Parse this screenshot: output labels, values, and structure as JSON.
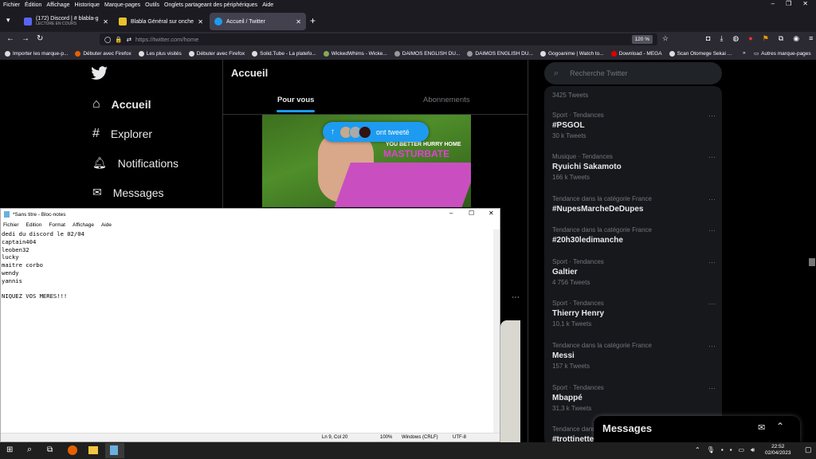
{
  "menubar": [
    "Fichier",
    "Édition",
    "Affichage",
    "Historique",
    "Marque-pages",
    "Outils",
    "Onglets partageant des périphériques",
    "Aide"
  ],
  "tabs": [
    {
      "title": "(172) Discord | #",
      "extra": "blabla-g",
      "sub": "LECTURE EN COURS",
      "color": "#5865f2"
    },
    {
      "title": "Blabla Général sur onche",
      "color": "#e8c12c"
    },
    {
      "title": "Accueil / Twitter",
      "color": "#1d9bf0"
    }
  ],
  "url": "https://twitter.com/home",
  "zoom": "120 %",
  "bookmarks": [
    "Importer les marque-p...",
    "Débuter avec Firefox",
    "Les plus visités",
    "Débuter avec Firefox",
    "Solid.Tube - La platefo...",
    "WickedWhims - Wicke...",
    "DAIMOS ENGLISH DU...",
    "DAIMOS ENGLISH DU...",
    "Gogoanime | Watch to...",
    "Download - MEGA",
    "Scan Otomege Sekai ..."
  ],
  "bookmarks_other": "Autres marque-pages",
  "twitter": {
    "nav": [
      "Accueil",
      "Explorer",
      "Notifications",
      "Messages"
    ],
    "header_title": "Accueil",
    "tab_for_you": "Pour vous",
    "tab_following": "Abonnements",
    "tweeted_pill": "ont tweeté",
    "image_text1": "YOU BETTER HURRY HOME",
    "image_text2": "MASTURBATE",
    "search_placeholder": "Recherche Twitter",
    "trends_first_count": "3425 Tweets",
    "trends": [
      {
        "cat": "Sport · Tendances",
        "name": "#PSGOL",
        "count": "30 k Tweets"
      },
      {
        "cat": "Musique · Tendances",
        "name": "Ryuichi Sakamoto",
        "count": "166 k Tweets"
      },
      {
        "cat": "Tendance dans la catégorie France",
        "name": "#NupesMarcheDeDupes",
        "count": ""
      },
      {
        "cat": "Tendance dans la catégorie France",
        "name": "#20h30ledimanche",
        "count": ""
      },
      {
        "cat": "Sport · Tendances",
        "name": "Galtier",
        "count": "4 756 Tweets"
      },
      {
        "cat": "Sport · Tendances",
        "name": "Thierry Henry",
        "count": "10,1 k Tweets"
      },
      {
        "cat": "Tendance dans la catégorie France",
        "name": "Messi",
        "count": "157 k Tweets"
      },
      {
        "cat": "Sport · Tendances",
        "name": "Mbappé",
        "count": "31,3 k Tweets"
      },
      {
        "cat": "Tendance dans la catégorie France",
        "name": "#trottinette",
        "count": ""
      }
    ],
    "messages_label": "Messages"
  },
  "notepad": {
    "title": "*Sans titre - Bloc-notes",
    "menu": [
      "Fichier",
      "Edition",
      "Format",
      "Affichage",
      "Aide"
    ],
    "text": "dedi du discord le 02/04\ncaptain404\nleoben32\nlucky\nmaitre corbo\nwendy\nyannis\n\nNIQUEZ VOS MERES!!!",
    "status_pos": "Ln 9, Col 20",
    "status_zoom": "100%",
    "status_eol": "Windows (CRLF)",
    "status_enc": "UTF-8"
  },
  "taskbar": {
    "time": "22:52",
    "date": "02/04/2023"
  }
}
